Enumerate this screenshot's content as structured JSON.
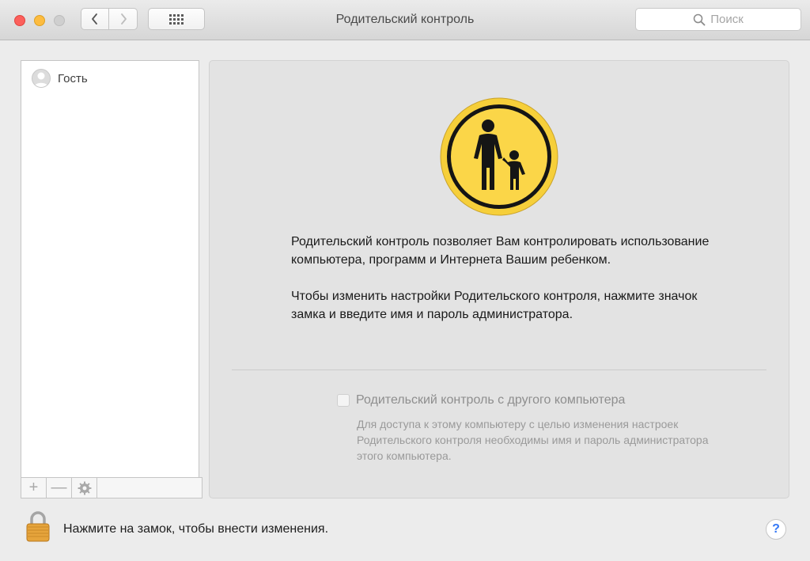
{
  "window": {
    "title": "Родительский контроль",
    "search_placeholder": "Поиск",
    "traffic_colors": {
      "close": "#fc605c",
      "minimize": "#fdbc40",
      "zoom": "#cfcfcf"
    }
  },
  "toolbar": {
    "back_icon": "chevron-left-icon",
    "forward_icon": "chevron-right-icon",
    "show_all_icon": "grid-icon"
  },
  "users": [
    {
      "name": "Гость",
      "icon": "user-avatar-icon"
    }
  ],
  "list_toolbar": {
    "add": "+",
    "remove": "—",
    "action_icon": "gear-icon"
  },
  "panel": {
    "icon": "parental-controls-icon",
    "accent_color": "#f6cf3a",
    "description_1": "Родительский контроль позволяет Вам контролировать использование компьютера, программ и Интернета Вашим ребенком.",
    "description_2": "Чтобы изменить настройки Родительского контроля, нажмите значок замка и введите имя и пароль администратора.",
    "remote_checkbox_label": "Родительский контроль с другого компьютера",
    "remote_checkbox_checked": false,
    "remote_note": "Для доступа к этому компьютеру с целью изменения настроек Родительского контроля необходимы имя и пароль администратора этого компьютера."
  },
  "footer": {
    "lock_icon": "lock-icon",
    "lock_text": "Нажмите на замок, чтобы внести изменения.",
    "help_label": "?"
  }
}
